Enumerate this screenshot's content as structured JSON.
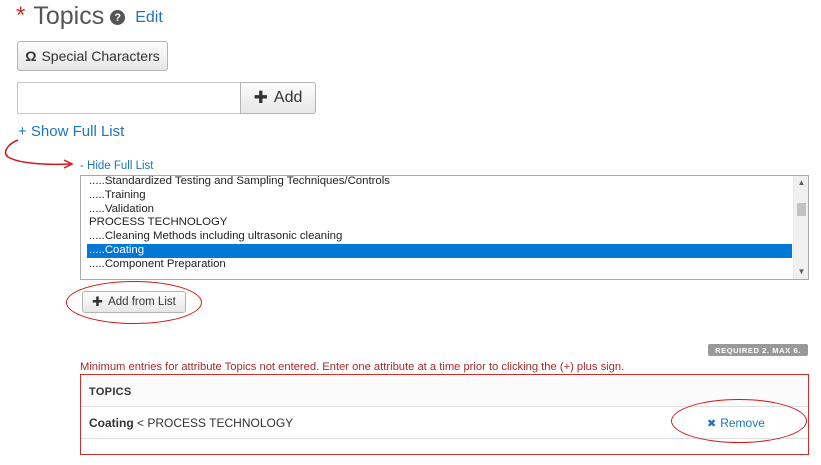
{
  "header": {
    "required_marker": "*",
    "title": "Topics",
    "help_glyph": "?",
    "edit_label": "Edit"
  },
  "special_characters": {
    "omega_glyph": "Ω",
    "label": "Special Characters"
  },
  "topic_input": {
    "value": "",
    "placeholder": ""
  },
  "add_button": {
    "icon": "plus-icon",
    "glyph": "✚",
    "label": "Add"
  },
  "show_full_list": "+ Show Full List",
  "hide_full_list": "- Hide Full List",
  "full_list": {
    "items": [
      ".....Standardized Testing and Sampling Techniques/Controls",
      ".....Training",
      ".....Validation",
      "PROCESS TECHNOLOGY",
      ".....Cleaning Methods including ultrasonic cleaning",
      ".....Coating",
      ".....Component Preparation"
    ],
    "selected_index": 5,
    "scroll_up_glyph": "▲",
    "scroll_down_glyph": "▼"
  },
  "add_from_list": {
    "glyph": "✚",
    "label": "Add from List"
  },
  "requirement_badge": "REQUIRED 2. MAX 6.",
  "error_message": "Minimum entries for attribute Topics not entered. Enter one attribute at a time prior to clicking the (+) plus sign.",
  "topics_table": {
    "header": "TOPICS",
    "rows": [
      {
        "topic": "Coating",
        "parent": " < PROCESS TECHNOLOGY",
        "remove_glyph": "✖",
        "remove_label": "Remove"
      }
    ]
  },
  "annotation_color": "#d0191b",
  "link_color": "#1e73be",
  "selection_color": "#0078d7"
}
